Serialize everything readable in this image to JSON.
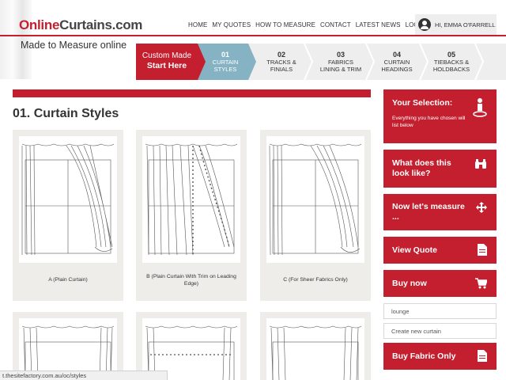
{
  "header": {
    "logo_part1": "Online",
    "logo_part2": "Curtains.com",
    "tagline": "Made to Measure online",
    "nav": [
      "HOME",
      "MY QUOTES",
      "HOW TO MEASURE",
      "CONTACT",
      "LATEST NEWS",
      "LOGOUT"
    ],
    "user_greeting": "HI, EMMA O'FARRELL"
  },
  "steps": {
    "cta_line1": "Custom Made",
    "cta_line2": "Start Here",
    "items": [
      {
        "num": "01",
        "label1": "CURTAIN",
        "label2": "STYLES"
      },
      {
        "num": "02",
        "label1": "TRACKS &",
        "label2": "FINIALS"
      },
      {
        "num": "03",
        "label1": "FABRICS",
        "label2": "LINING & TRIM"
      },
      {
        "num": "04",
        "label1": "CURTAIN",
        "label2": "HEADINGS"
      },
      {
        "num": "05",
        "label1": "TIEBACKS &",
        "label2": "HOLDBACKS"
      }
    ],
    "active_index": 0
  },
  "main": {
    "title": "01. Curtain Styles",
    "cards": [
      {
        "caption": "A (Plain Curtain)"
      },
      {
        "caption": "B (Plain Curtain With Trim on Leading Edge)"
      },
      {
        "caption": "C (For Sheer Fabrics Only)"
      },
      {
        "caption": ""
      },
      {
        "caption": ""
      },
      {
        "caption": ""
      }
    ]
  },
  "sidebar": {
    "selection_title": "Your Selection:",
    "selection_sub": "Everything you have chosen will list below",
    "look_title": "What does this look like?",
    "measure_title": "Now let's measure ...",
    "quote_title": "View Quote",
    "buy_title": "Buy now",
    "field_value": "lounge",
    "field2_value": "Create new curtain",
    "fabric_title": "Buy Fabric Only"
  },
  "status": {
    "url": "t.thesitefactory.com.au/oc/styles"
  },
  "colors": {
    "brand_red": "#c41f2f",
    "active_step": "#86b3c4",
    "card_bg": "#eeedea"
  }
}
